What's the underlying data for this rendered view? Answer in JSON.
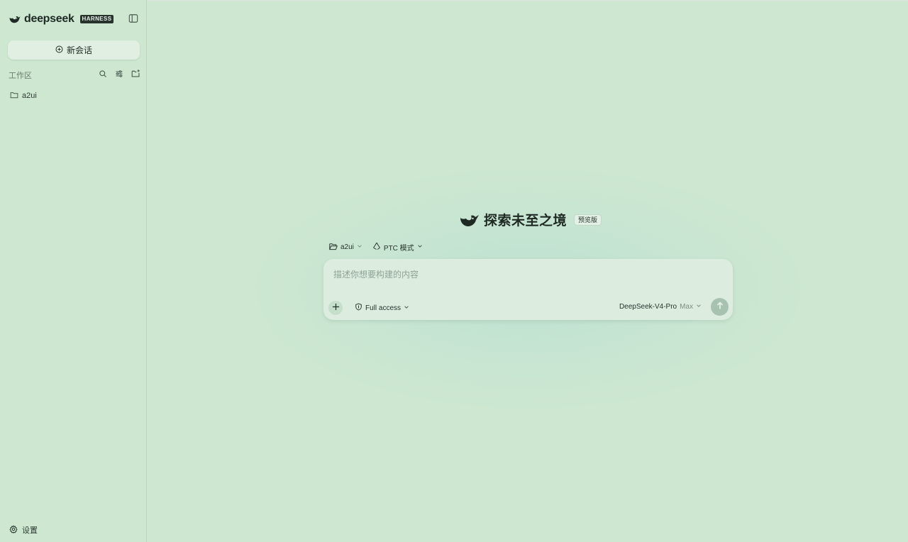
{
  "brand": {
    "name": "deepseek",
    "badge": "HARNESS"
  },
  "sidebar": {
    "new_chat_label": "新会话",
    "workspace_title": "工作区",
    "items": [
      {
        "label": "a2ui",
        "icon": "folder-icon"
      }
    ],
    "settings_label": "设置"
  },
  "main": {
    "hero_title": "探索未至之境",
    "hero_badge": "预览版",
    "workspace_chip": "a2ui",
    "mode_chip": "PTC 模式",
    "composer": {
      "placeholder": "描述你想要构建的内容",
      "access_label": "Full access",
      "model_name": "DeepSeek-V4-Pro",
      "model_tier": "Max"
    }
  },
  "colors": {
    "background": "#cde7d1",
    "composer": "#dcede0",
    "send_button": "#a8c2b0",
    "text": "#22302a"
  }
}
